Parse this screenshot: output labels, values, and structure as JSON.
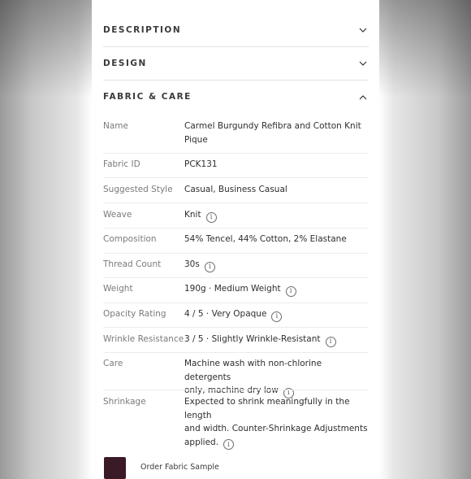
{
  "sections": {
    "description": {
      "title": "DESCRIPTION"
    },
    "design": {
      "title": "DESIGN"
    },
    "fabric_care": {
      "title": "FABRIC & CARE"
    }
  },
  "specs": [
    {
      "label": "Name",
      "value_line1": "Carmel Burgundy Refibra and Cotton Knit",
      "value_line2": "Pique"
    },
    {
      "label": "Fabric ID",
      "value": "PCK131"
    },
    {
      "label": "Suggested Style",
      "value": "Casual, Business Casual"
    },
    {
      "label": "Weave",
      "value": "Knit",
      "info": true
    },
    {
      "label": "Composition",
      "value": "54% Tencel, 44% Cotton, 2% Elastane"
    },
    {
      "label": "Thread Count",
      "value": "30s",
      "info": true
    },
    {
      "label": "Weight",
      "value": "190g · Medium Weight",
      "info": true
    },
    {
      "label": "Opacity Rating",
      "value": "4 / 5 · Very Opaque",
      "info": true
    },
    {
      "label": "Wrinkle Resistance",
      "value": "3 / 5 · Slightly Wrinkle-Resistant",
      "info": true
    },
    {
      "label": "Care",
      "value_line1": "Machine wash with non-chlorine detergents",
      "value_line2": "only, machine dry low",
      "info": true
    },
    {
      "label": "Shrinkage",
      "value_line1": "Expected to shrink meaningfully in the length",
      "value_line2": "and width. Counter-Shrinkage Adjustments",
      "value_line3": "applied.",
      "info": true
    }
  ],
  "info_glyph": "i",
  "sample": {
    "label": "Order Fabric Sample",
    "swatch_color": "#3a1a26"
  },
  "icons": {
    "collapsed": "chevron-down-icon",
    "expanded": "chevron-up-icon",
    "info": "info-icon"
  }
}
